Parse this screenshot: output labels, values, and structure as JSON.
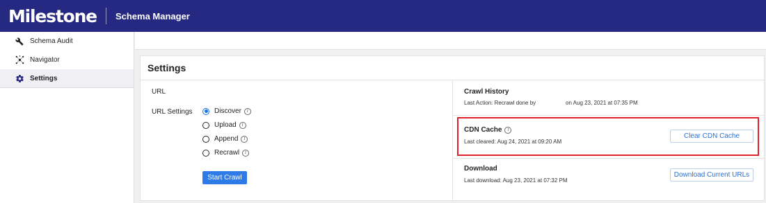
{
  "header": {
    "logo": "Milestone",
    "app_title": "Schema Manager",
    "bar_color": "#252982"
  },
  "sidebar": {
    "items": [
      {
        "label": "Schema Audit",
        "icon": "wrench-icon",
        "active": false
      },
      {
        "label": "Navigator",
        "icon": "network-icon",
        "active": false
      },
      {
        "label": "Settings",
        "icon": "gear-icon",
        "active": true
      }
    ]
  },
  "settings": {
    "title": "Settings",
    "url_label": "URL",
    "url_settings_label": "URL Settings",
    "options": [
      {
        "label": "Discover",
        "checked": true
      },
      {
        "label": "Upload",
        "checked": false
      },
      {
        "label": "Append",
        "checked": false
      },
      {
        "label": "Recrawl",
        "checked": false
      }
    ],
    "start_button": "Start Crawl"
  },
  "crawl_history": {
    "title": "Crawl History",
    "last_action_prefix": "Last Action: Recrawl done by",
    "last_action_date": "on Aug 23, 2021 at 07:35 PM"
  },
  "cdn_cache": {
    "title": "CDN Cache",
    "last_cleared": "Last cleared: Aug 24, 2021 at 09:20 AM",
    "button": "Clear CDN Cache"
  },
  "download": {
    "title": "Download",
    "last_download": "Last download: Aug 23, 2021 at 07:32 PM",
    "button": "Download Current URLs"
  },
  "colors": {
    "accent": "#2e7be8",
    "highlight": "#e0202a"
  }
}
